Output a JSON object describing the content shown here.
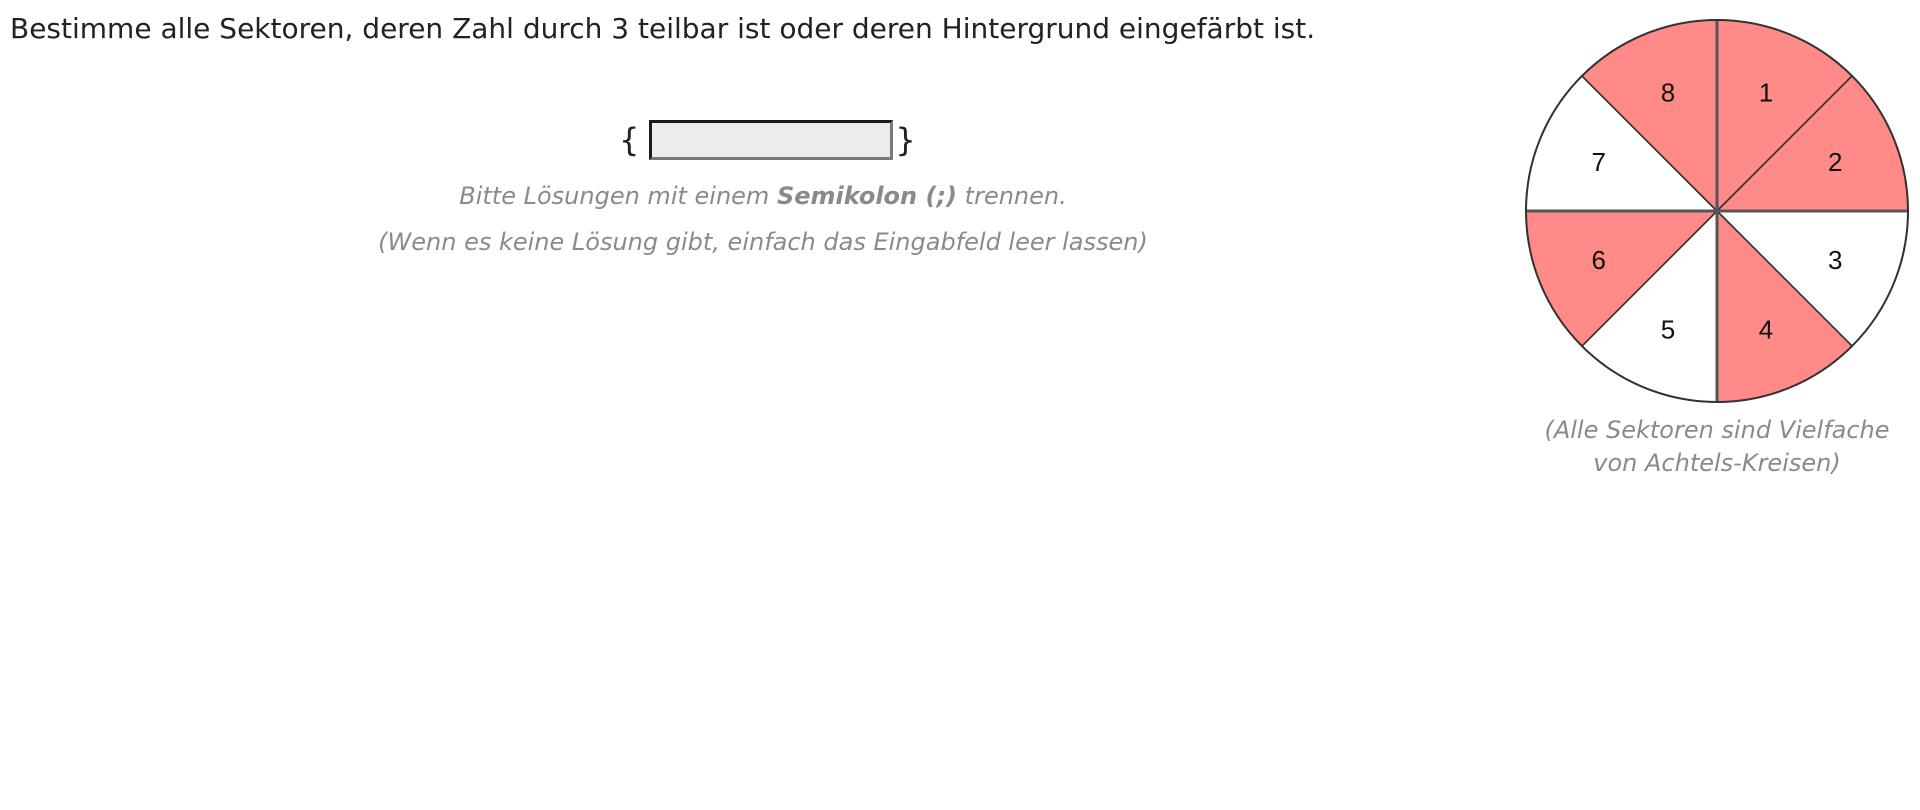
{
  "question": {
    "text": "Bestimme alle Sektoren, deren Zahl durch 3 teilbar ist oder deren Hintergrund eingefärbt ist."
  },
  "answer": {
    "open_brace": "{",
    "close_brace": "}",
    "value": ""
  },
  "hints": {
    "line1_before": "Bitte Lösungen mit einem ",
    "line1_bold": "Semikolon (;)",
    "line1_after": " trennen.",
    "line2": "(Wenn es keine Lösung gibt, einfach das Eingabfeld leer lassen)"
  },
  "wheel": {
    "fill_color": "#ff8a87",
    "empty_color": "#ffffff",
    "sectors": [
      {
        "label": "1",
        "colored": true
      },
      {
        "label": "2",
        "colored": true
      },
      {
        "label": "3",
        "colored": false
      },
      {
        "label": "4",
        "colored": true
      },
      {
        "label": "5",
        "colored": false
      },
      {
        "label": "6",
        "colored": true
      },
      {
        "label": "7",
        "colored": false
      },
      {
        "label": "8",
        "colored": true
      }
    ],
    "caption_line1": "(Alle Sektoren sind Vielfache",
    "caption_line2": "von Achtels-Kreisen)"
  }
}
